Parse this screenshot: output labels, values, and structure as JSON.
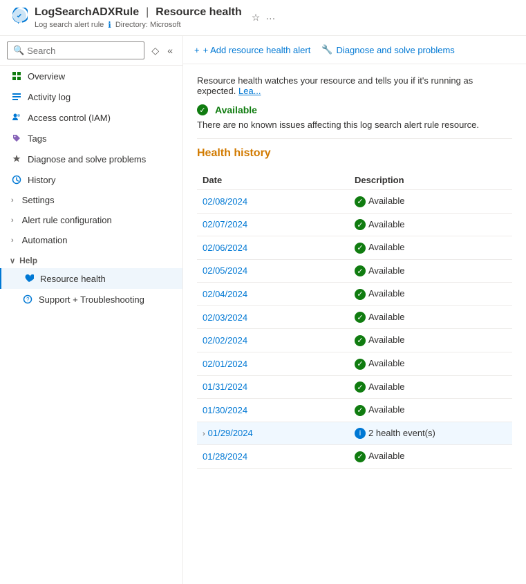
{
  "header": {
    "icon": "💙",
    "resource_name": "LogSearchADXRule",
    "separator": "|",
    "page_title": "Resource health",
    "resource_type": "Log search alert rule",
    "directory_label": "Directory: Microsoft",
    "star_tooltip": "Favorite",
    "more_tooltip": "More"
  },
  "search": {
    "placeholder": "Search"
  },
  "nav": {
    "items": [
      {
        "id": "overview",
        "label": "Overview",
        "icon": "grid"
      },
      {
        "id": "activity-log",
        "label": "Activity log",
        "icon": "list"
      },
      {
        "id": "access-control",
        "label": "Access control (IAM)",
        "icon": "people"
      },
      {
        "id": "tags",
        "label": "Tags",
        "icon": "tag"
      },
      {
        "id": "diagnose",
        "label": "Diagnose and solve problems",
        "icon": "wrench"
      },
      {
        "id": "history",
        "label": "History",
        "icon": "clock"
      },
      {
        "id": "settings",
        "label": "Settings",
        "icon": "chevron-right",
        "expandable": true
      },
      {
        "id": "alert-rule",
        "label": "Alert rule configuration",
        "icon": "chevron-right",
        "expandable": true
      },
      {
        "id": "automation",
        "label": "Automation",
        "icon": "chevron-right",
        "expandable": true
      }
    ],
    "help_section": {
      "label": "Help",
      "chevron": "∨",
      "children": [
        {
          "id": "resource-health",
          "label": "Resource health",
          "icon": "heart",
          "active": true
        },
        {
          "id": "support",
          "label": "Support + Troubleshooting",
          "icon": "question"
        }
      ]
    }
  },
  "toolbar": {
    "add_alert_label": "+ Add resource health alert",
    "diagnose_label": "Diagnose and solve problems"
  },
  "content": {
    "info_text": "Resource health watches your resource and tells you if it's running as expected.",
    "info_link": "Lea...",
    "status": {
      "icon": "check",
      "label": "Available",
      "message": "There are no known issues affecting this log search alert rule resource."
    },
    "health_history": {
      "title": "Health history",
      "columns": {
        "date": "Date",
        "description": "Description"
      },
      "rows": [
        {
          "date": "02/08/2024",
          "type": "available",
          "description": "Available",
          "expandable": false
        },
        {
          "date": "02/07/2024",
          "type": "available",
          "description": "Available",
          "expandable": false
        },
        {
          "date": "02/06/2024",
          "type": "available",
          "description": "Available",
          "expandable": false
        },
        {
          "date": "02/05/2024",
          "type": "available",
          "description": "Available",
          "expandable": false
        },
        {
          "date": "02/04/2024",
          "type": "available",
          "description": "Available",
          "expandable": false
        },
        {
          "date": "02/03/2024",
          "type": "available",
          "description": "Available",
          "expandable": false
        },
        {
          "date": "02/02/2024",
          "type": "available",
          "description": "Available",
          "expandable": false
        },
        {
          "date": "02/01/2024",
          "type": "available",
          "description": "Available",
          "expandable": false
        },
        {
          "date": "01/31/2024",
          "type": "available",
          "description": "Available",
          "expandable": false
        },
        {
          "date": "01/30/2024",
          "type": "available",
          "description": "Available",
          "expandable": false
        },
        {
          "date": "01/29/2024",
          "type": "events",
          "description": "2 health event(s)",
          "expandable": true
        },
        {
          "date": "01/28/2024",
          "type": "available",
          "description": "Available",
          "expandable": false
        }
      ]
    }
  }
}
